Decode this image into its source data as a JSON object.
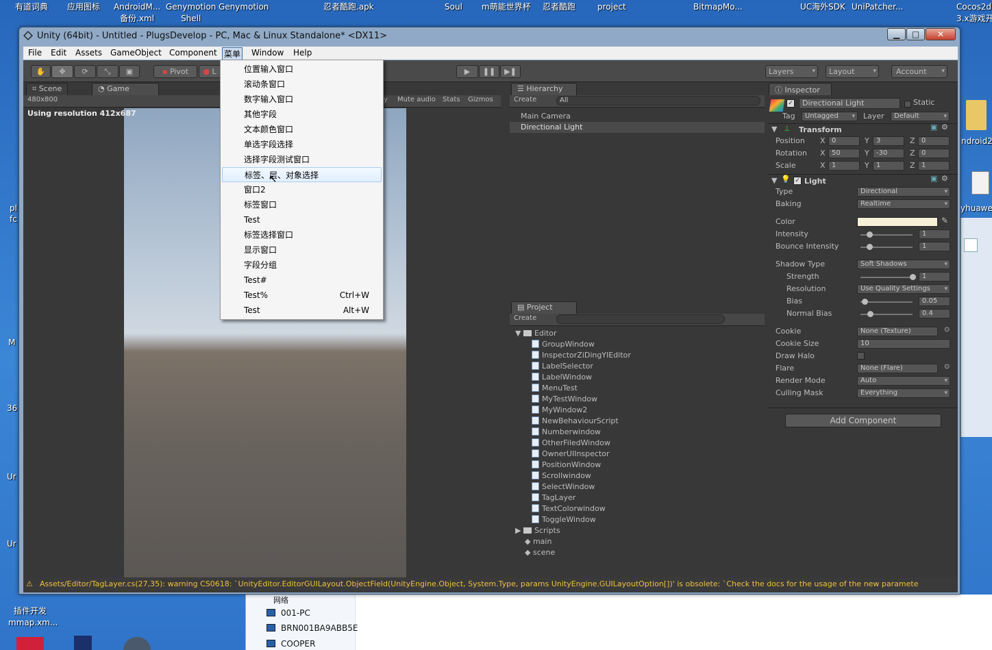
{
  "desktop": {
    "icons": [
      "有道词典",
      "应用图标",
      "AndroidM...\n备份.xml",
      "Genymotion\nShell",
      "Genymotion",
      "忍者酷跑.apk",
      "Soul",
      "m萌能世界杯",
      "忍者酷跑",
      "project",
      "BitmapMo...",
      "UC海外SDK",
      "UniPatcher...",
      "Cocos2d\n3.x游戏开",
      "插件开发",
      "mmap.xm...",
      "ndroid2",
      "yhuawei"
    ],
    "left_frags": [
      "pl",
      "fc",
      "M",
      "Ur",
      "Ur",
      "36"
    ]
  },
  "explorer": {
    "section": "网络",
    "items": [
      "001-PC",
      "BRN001BA9ABB5E",
      "COOPER"
    ]
  },
  "window": {
    "title": "Unity (64bit) - Untitled - PlugsDevelop - PC, Mac & Linux Standalone* <DX11>",
    "minimize": "▁",
    "maximize": "□",
    "close": "✕"
  },
  "menubar": [
    "File",
    "Edit",
    "Assets",
    "GameObject",
    "Component",
    "菜单",
    "Window",
    "Help"
  ],
  "toolbar": {
    "pivot": "Pivot",
    "local": "L",
    "layers": "Layers",
    "layout": "Layout",
    "account": "Account"
  },
  "scene": {
    "tab_scene": "Scene",
    "tab_game": "Game",
    "resolution_dropdown": "480x800",
    "resolution_text": "Using resolution 412x687",
    "mute_audio": "Mute audio",
    "stats": "Stats",
    "gizmos": "Gizmos",
    "frag": "y"
  },
  "dropdown_menu": [
    {
      "label": "位置输入窗口",
      "shortcut": ""
    },
    {
      "label": "滚动条窗口",
      "shortcut": ""
    },
    {
      "label": "数字输入窗口",
      "shortcut": ""
    },
    {
      "label": "其他字段",
      "shortcut": ""
    },
    {
      "label": "文本颜色窗口",
      "shortcut": ""
    },
    {
      "label": "单选字段选择",
      "shortcut": ""
    },
    {
      "label": "选择字段测试窗口",
      "shortcut": ""
    },
    {
      "label": "标签、层、对象选择",
      "shortcut": ""
    },
    {
      "label": "窗口2",
      "shortcut": ""
    },
    {
      "label": "标签窗口",
      "shortcut": ""
    },
    {
      "label": "Test",
      "shortcut": ""
    },
    {
      "label": "标签选择窗口",
      "shortcut": ""
    },
    {
      "label": "显示窗口",
      "shortcut": ""
    },
    {
      "label": "字段分组",
      "shortcut": ""
    },
    {
      "label": "Test#",
      "shortcut": ""
    },
    {
      "label": "Test%",
      "shortcut": "Ctrl+W"
    },
    {
      "label": "Test",
      "shortcut": "Alt+W"
    }
  ],
  "hierarchy": {
    "tab": "Hierarchy",
    "create": "Create",
    "search": "All",
    "items": [
      "Main Camera",
      "Directional Light"
    ]
  },
  "project": {
    "tab": "Project",
    "create": "Create",
    "editor_folder": "Editor",
    "editor_items": [
      "GroupWindow",
      "InspectorZiDingYIEditor",
      "LabelSelector",
      "LabelWindow",
      "MenuTest",
      "MyTestWindow",
      "MyWindow2",
      "NewBehaviourScript",
      "Numberwindow",
      "OtherFiledWindow",
      "OwnerUIInspector",
      "PositionWindow",
      "Scrollwindow",
      "SelectWindow",
      "TagLayer",
      "TextColorwindow",
      "ToggleWindow"
    ],
    "other_items": [
      "Scripts",
      "main",
      "scene"
    ]
  },
  "inspector": {
    "tab": "Inspector",
    "object_name": "Directional Light",
    "static": "Static",
    "tag_label": "Tag",
    "tag_value": "Untagged",
    "layer_label": "Layer",
    "layer_value": "Default",
    "transform": {
      "title": "Transform",
      "position_label": "Position",
      "position": [
        "0",
        "3",
        "0"
      ],
      "rotation_label": "Rotation",
      "rotation": [
        "50",
        "-30",
        "0"
      ],
      "scale_label": "Scale",
      "scale": [
        "1",
        "1",
        "1"
      ],
      "axes": [
        "X",
        "Y",
        "Z"
      ]
    },
    "light": {
      "title": "Light",
      "type_label": "Type",
      "type": "Directional",
      "baking_label": "Baking",
      "baking": "Realtime",
      "color_label": "Color",
      "color": "#f7f1d8",
      "intensity_label": "Intensity",
      "intensity": "1",
      "intensity_fraction": 0.125,
      "bounce_label": "Bounce Intensity",
      "bounce": "1",
      "bounce_fraction": 0.125,
      "shadow_type_label": "Shadow Type",
      "shadow_type": "Soft Shadows",
      "strength_label": "Strength",
      "strength": "1",
      "strength_fraction": 1,
      "resolution_label": "Resolution",
      "resolution": "Use Quality Settings",
      "bias_label": "Bias",
      "bias": "0.05",
      "bias_fraction": 0.025,
      "normal_bias_label": "Normal Bias",
      "normal_bias": "0.4",
      "normal_bias_fraction": 0.133,
      "cookie_label": "Cookie",
      "cookie": "None (Texture)",
      "cookie_size_label": "Cookie Size",
      "cookie_size": "10",
      "draw_halo_label": "Draw Halo",
      "flare_label": "Flare",
      "flare": "None (Flare)",
      "render_mode_label": "Render Mode",
      "render_mode": "Auto",
      "culling_label": "Culling Mask",
      "culling": "Everything"
    },
    "add_component": "Add Component"
  },
  "status": "Assets/Editor/TagLayer.cs(27,35): warning CS0618: `UnityEditor.EditorGUILayout.ObjectField(UnityEngine.Object, System.Type, params UnityEngine.GUILayoutOption[])' is obsolete: `Check the docs for the usage of the new paramete"
}
